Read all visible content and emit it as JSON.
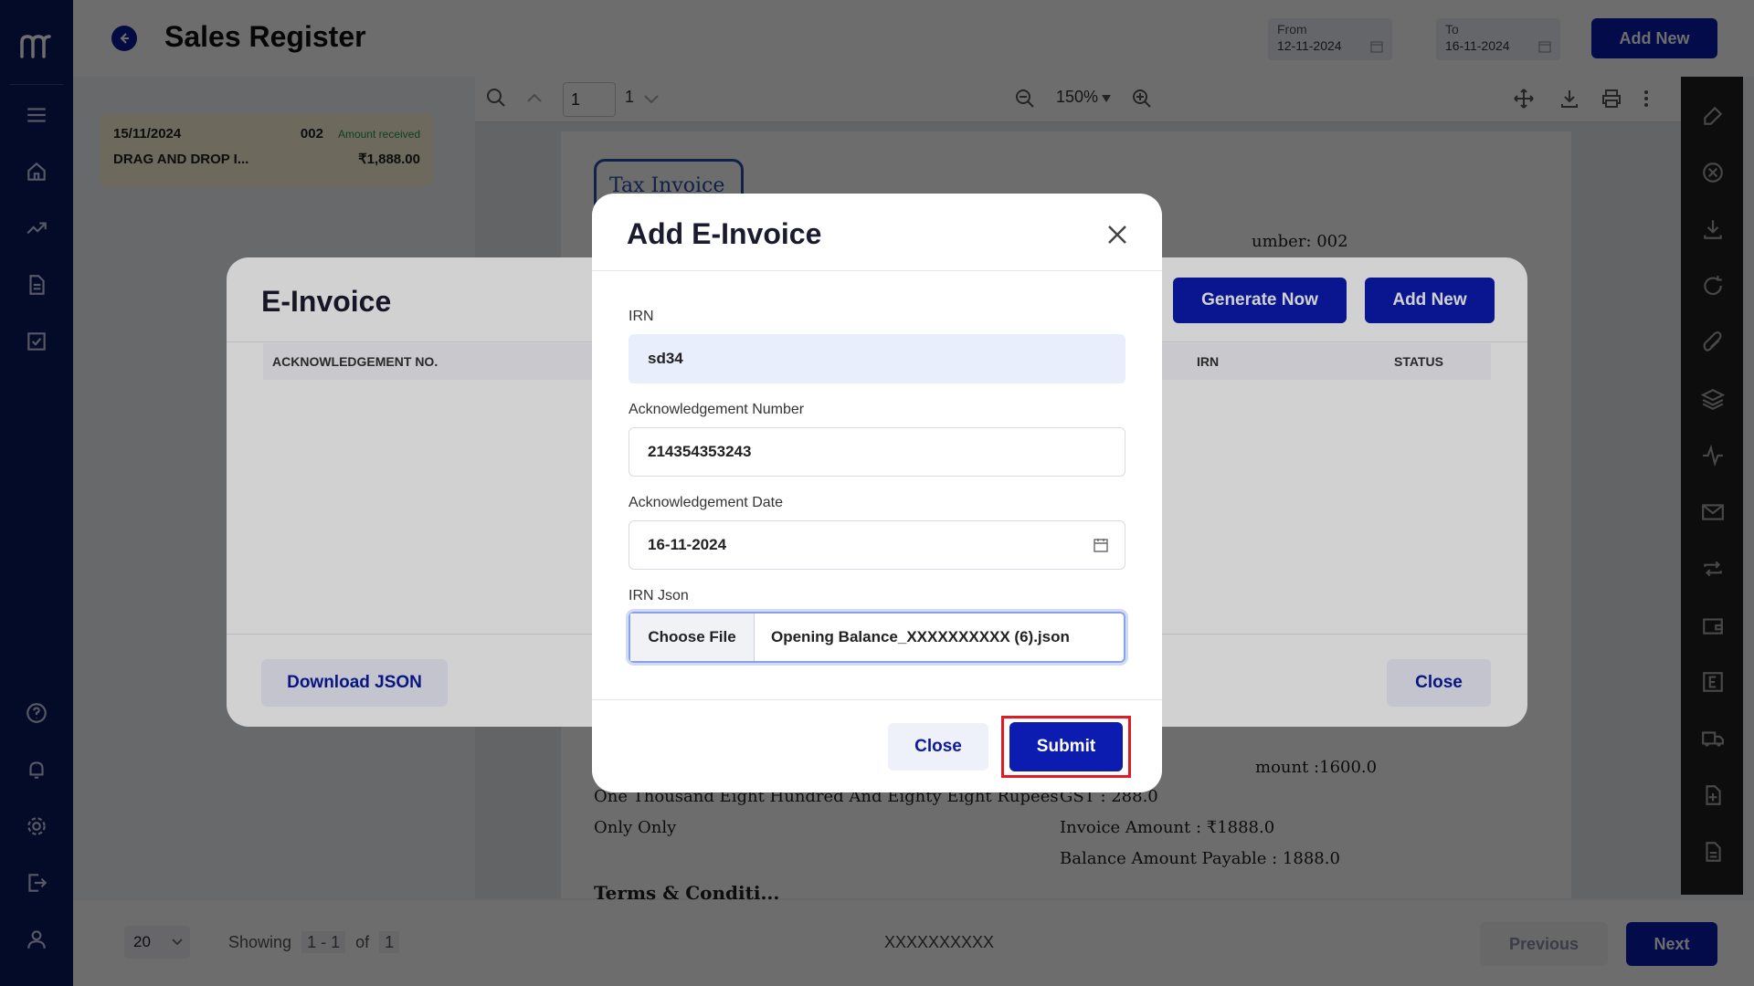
{
  "header": {
    "title": "Sales Register",
    "from_label": "From",
    "from_value": "12-11-2024",
    "to_label": "To",
    "to_value": "16-11-2024",
    "add_new_label": "Add New"
  },
  "list": {
    "card": {
      "date": "15/11/2024",
      "number": "002",
      "status": "Amount received",
      "name": "DRAG AND DROP I...",
      "amount": "₹1,888.00"
    }
  },
  "viewer": {
    "page_value": "1",
    "page_total": "1",
    "zoom": "150%",
    "doc": {
      "badge": "Tax Invoice",
      "number_text": "umber: 002",
      "words_line1": "One Thousand Eight Hundred And Eighty Eight Rupees",
      "words_line2": "Only Only",
      "amount_line": "mount :1600.0",
      "gst_line": "GST : 288.0",
      "invoice_amount": "Invoice Amount : ₹1888.0",
      "balance": "Balance Amount Payable : 1888.0",
      "terms": "Terms & Conditi..."
    }
  },
  "footer": {
    "page_size": "20",
    "showing_label": "Showing",
    "showing_range": "1 - 1",
    "of_label": "of",
    "total": "1",
    "center_text": "XXXXXXXXXX",
    "previous_label": "Previous",
    "next_label": "Next"
  },
  "einvoice": {
    "title": "E-Invoice",
    "generate_label": "Generate Now",
    "add_new_label": "Add New",
    "columns": [
      "ACKNOWLEDGEMENT NO.",
      "IRN",
      "STATUS"
    ],
    "download_label": "Download JSON",
    "close_label": "Close"
  },
  "add_einvoice": {
    "title": "Add E-Invoice",
    "irn_label": "IRN",
    "irn_value": "sd34",
    "ack_no_label": "Acknowledgement Number",
    "ack_no_value": "214354353243",
    "ack_date_label": "Acknowledgement Date",
    "ack_date_value": "16-11-2024",
    "json_label": "IRN Json",
    "choose_label": "Choose File",
    "file_name": "Opening Balance_XXXXXXXXXX (6).json",
    "close_label": "Close",
    "submit_label": "Submit"
  },
  "colors": {
    "nav_bg": "#0c1b5e",
    "primary": "#0c1bb0",
    "highlight": "#e01b24"
  }
}
